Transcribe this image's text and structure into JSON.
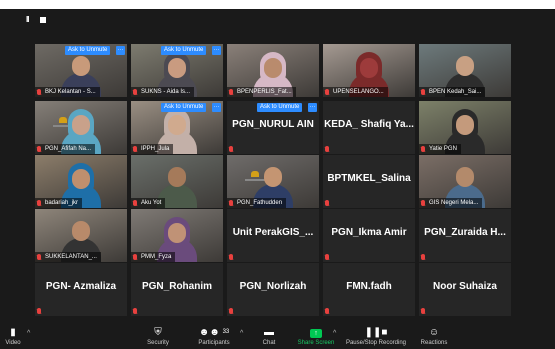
{
  "toolbar_top": {
    "pause": "II",
    "stop": "■"
  },
  "tiles": [
    {
      "name": "BKJ Kelantan - S...",
      "unmute": "Ask to Unmute",
      "more": "···",
      "type": "photo"
    },
    {
      "name": "SUKNS - Aida Is...",
      "unmute": "Ask to Unmute",
      "more": "···",
      "type": "photo"
    },
    {
      "name": "BPENPERLIS_Fat...",
      "type": "photo"
    },
    {
      "name": "UPENSELANGO...",
      "type": "photo"
    },
    {
      "name": "BPEN Kedah_Sai...",
      "type": "photo"
    },
    {
      "name": "PGN_Afifah Na...",
      "type": "photo"
    },
    {
      "name": "IPPH_Jula",
      "unmute": "Ask to Unmute",
      "more": "···",
      "type": "photo"
    },
    {
      "big": "PGN_NURUL AIN",
      "unmute": "Ask to Unmute",
      "more": "···",
      "type": "text"
    },
    {
      "big": "KEDA_ Shafiq Ya...",
      "type": "text"
    },
    {
      "name": "Yatie PGN",
      "type": "photo"
    },
    {
      "name": "badariah_jkr",
      "type": "photo"
    },
    {
      "name": "Aku Yot",
      "type": "photo"
    },
    {
      "name": "PGN_Fathudden",
      "type": "photo"
    },
    {
      "big": "BPTMKEL_Salina",
      "type": "text"
    },
    {
      "name": "GIS Negeri Mela...",
      "type": "photo"
    },
    {
      "name": "SUKKELANTAN_...",
      "type": "photo"
    },
    {
      "name": "PMM_Fyza",
      "type": "photo"
    },
    {
      "big": "Unit PerakGIS_...",
      "type": "text"
    },
    {
      "big": "PGN_Ikma Amir",
      "type": "text"
    },
    {
      "big": "PGN_Zuraida H...",
      "type": "text"
    },
    {
      "big": "PGN- Azmaliza",
      "type": "text"
    },
    {
      "big": "PGN_Rohanim",
      "type": "text"
    },
    {
      "big": "PGN_Norlizah",
      "type": "text"
    },
    {
      "big": "FMN.fadh",
      "type": "text"
    },
    {
      "big": "Noor Suhaiza",
      "type": "text"
    }
  ],
  "bottom": {
    "video": "Video",
    "security": "Security",
    "participants": "Participants",
    "participants_count": "33",
    "chat": "Chat",
    "share": "Share Screen",
    "record": "Pause/Stop Recording",
    "reactions": "Reactions"
  },
  "colors": {
    "accent": "#2d8cff",
    "mute": "#e8413e",
    "share": "#18c964"
  }
}
